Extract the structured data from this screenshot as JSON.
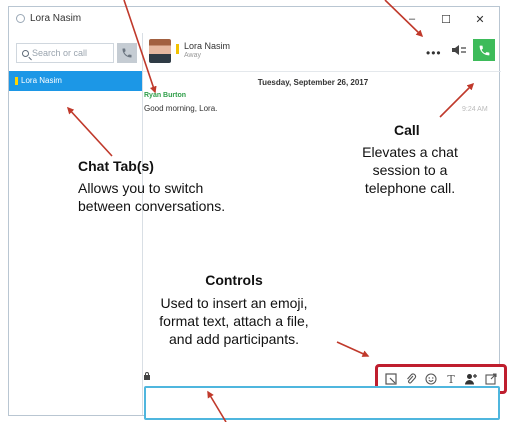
{
  "window": {
    "title": "Lora Nasim",
    "controls": {
      "minimize": "–",
      "maximize": "☐",
      "close": "✕"
    }
  },
  "sidebar": {
    "search": {
      "placeholder": "Search or call"
    },
    "tabs": [
      {
        "label": "Lora Nasim",
        "selected": true
      }
    ]
  },
  "header": {
    "contact_name": "Lora Nasim",
    "contact_status": "Away",
    "more_label": "•••"
  },
  "conversation": {
    "date": "Tuesday, September 26, 2017",
    "messages": [
      {
        "sender": "Ryan Burton",
        "text": "Good morning, Lora.",
        "time": "9:24 AM"
      }
    ]
  },
  "annotations": {
    "chat_tabs": {
      "title": "Chat Tab(s)",
      "lines": [
        "Allows you to switch",
        "between conversations."
      ]
    },
    "call": {
      "title": "Call",
      "lines": [
        "Elevates a chat",
        "session to a",
        "telephone call."
      ]
    },
    "controls": {
      "title": "Controls",
      "lines": [
        "Used to insert an emoji,",
        "format text, attach a file,",
        "and add participants."
      ]
    }
  },
  "toolbar": {
    "tools": [
      "screenshot-icon",
      "attach-icon",
      "emoji-icon",
      "format-text-icon",
      "add-participant-icon",
      "popout-icon"
    ],
    "format_label": "T"
  },
  "colors": {
    "tab_selected": "#1c97e6",
    "call_button": "#3dbb5a",
    "presence": "#f2c200",
    "sender": "#2e9e48",
    "highlight_box": "#bf1e2e",
    "arrow": "#c0392b",
    "compose_border": "#4fb6de"
  }
}
